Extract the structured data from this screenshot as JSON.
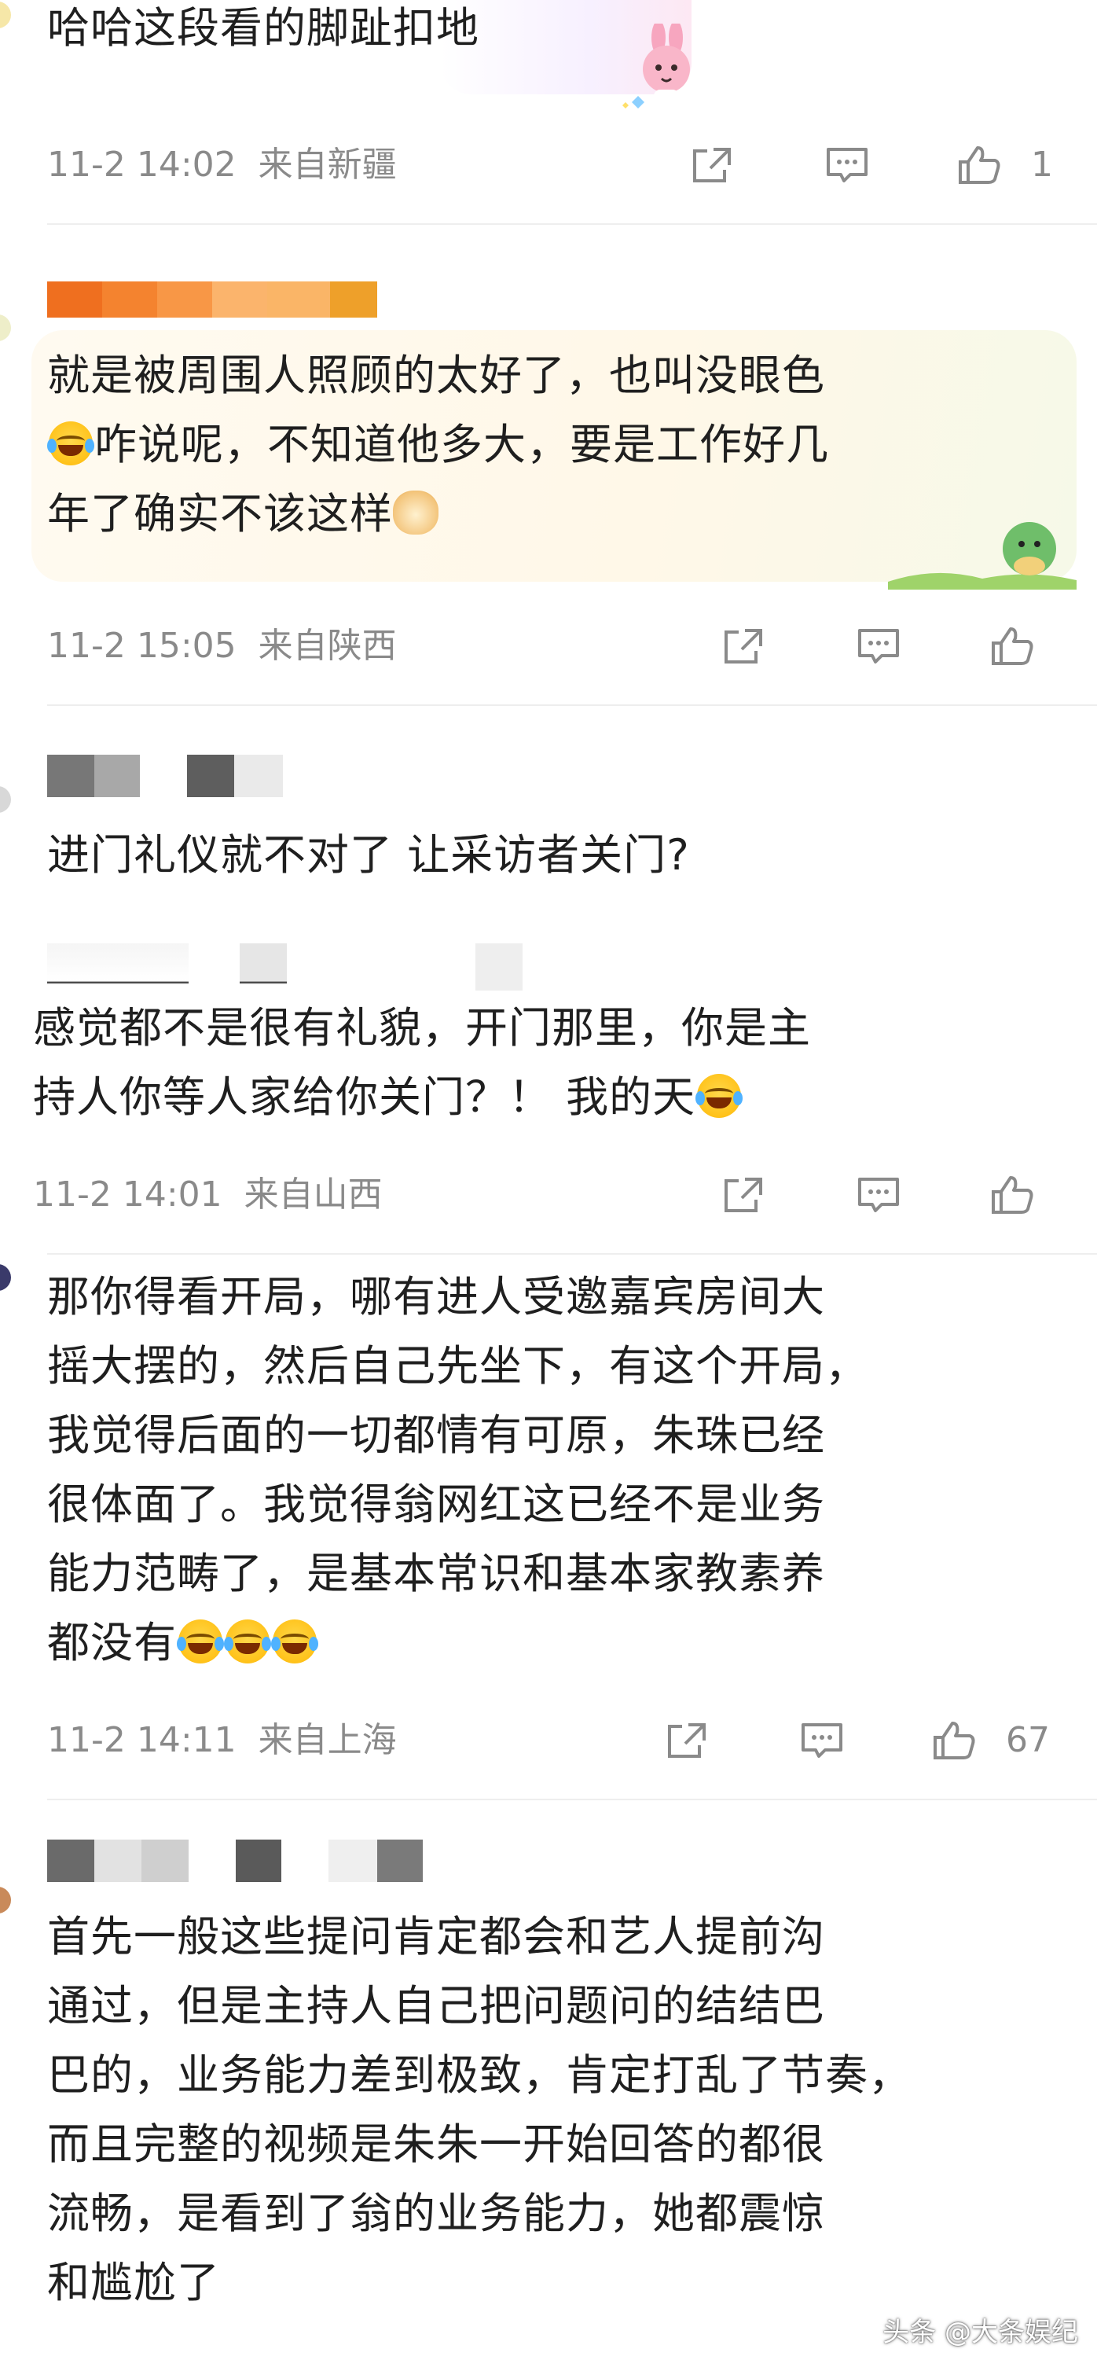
{
  "comments": [
    {
      "text": "哈哈这段看的脚趾扣地",
      "time": "11-2 14:02",
      "location": "来自新疆",
      "likes": "1",
      "icons": [
        "share-icon",
        "comment-icon",
        "like-icon"
      ]
    },
    {
      "text_line1": "就是被周围人照顾的太好了，也叫没眼色",
      "text_line2": "咋说呢，不知道他多大，要是工作好几",
      "text_line3": "年了确实不该这样",
      "time": "11-2 15:05",
      "location": "来自陕西",
      "likes": ""
    },
    {
      "text": "进门礼仪就不对了 让采访者关门?",
      "reply_line1": "感觉都不是很有礼貌，开门那里，你是主",
      "reply_line2": "持人你等人家给你关门？！ 我的天",
      "time": "11-2 14:01",
      "location": "来自山西",
      "likes": ""
    },
    {
      "text_line1": "那你得看开局，哪有进人受邀嘉宾房间大",
      "text_line2": "摇大摆的，然后自己先坐下，有这个开局，",
      "text_line3": "我觉得后面的一切都情有可原，朱珠已经",
      "text_line4": "很体面了。我觉得翁网红这已经不是业务",
      "text_line5": "能力范畴了，是基本常识和基本家教素养",
      "text_line6": "都没有",
      "time": "11-2 14:11",
      "location": "来自上海",
      "likes": "67"
    },
    {
      "text_line1": "首先一般这些提问肯定都会和艺人提前沟",
      "text_line2": "通过，但是主持人自己把问题问的结结巴",
      "text_line3": "巴的，业务能力差到极致，肯定打乱了节奏，",
      "text_line4": "而且完整的视频是朱朱一开始回答的都很",
      "text_line5": "流畅，是看到了翁的业务能力，她都震惊",
      "text_line6": "和尴尬了"
    }
  ],
  "watermark": "头条 @大条娱纪",
  "colors": {
    "meta": "#8a8a8a",
    "text": "#1f1f1f",
    "divider": "#eeeeee",
    "name_bar": [
      "#f07a2a",
      "#f58c3a",
      "#f89e50",
      "#fbb86a",
      "#f9c070",
      "#f0a030"
    ]
  }
}
